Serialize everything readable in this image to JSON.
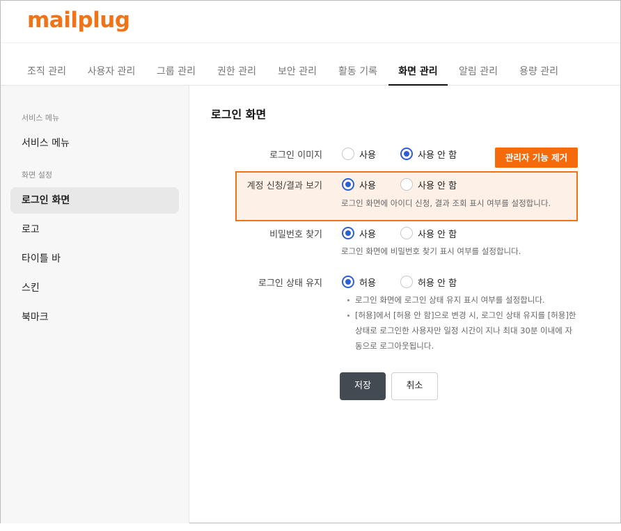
{
  "brand": {
    "logo_text": "mailplug",
    "color": "#f07318"
  },
  "nav": {
    "tabs": [
      {
        "label": "조직 관리"
      },
      {
        "label": "사용자 관리"
      },
      {
        "label": "그룹 관리"
      },
      {
        "label": "권한 관리"
      },
      {
        "label": "보안 관리"
      },
      {
        "label": "활동 기록"
      },
      {
        "label": "화면 관리",
        "active": true
      },
      {
        "label": "알림 관리"
      },
      {
        "label": "용량 관리"
      }
    ]
  },
  "sidebar": {
    "section1_heading": "서비스 메뉴",
    "section1_items": [
      {
        "label": "서비스 메뉴"
      }
    ],
    "section2_heading": "화면 설정",
    "section2_items": [
      {
        "label": "로그인 화면",
        "active": true
      },
      {
        "label": "로고"
      },
      {
        "label": "타이틀 바"
      },
      {
        "label": "스킨"
      },
      {
        "label": "북마크"
      }
    ]
  },
  "main": {
    "title": "로그인 화면",
    "badge": "관리자 기능 제거",
    "settings": [
      {
        "label": "로그인 이미지",
        "options": [
          "사용",
          "사용 안 함"
        ],
        "selected": "사용 안 함"
      },
      {
        "label": "계정 신청/결과 보기",
        "options": [
          "사용",
          "사용 안 함"
        ],
        "selected": "사용",
        "desc": "로그인 화면에 아이디 신청, 결과 조회 표시 여부를 설정합니다."
      },
      {
        "label": "비밀번호 찾기",
        "options": [
          "사용",
          "사용 안 함"
        ],
        "selected": "사용",
        "desc": "로그인 화면에 비밀번호 찾기 표시 여부를 설정합니다."
      },
      {
        "label": "로그인 상태 유지",
        "options": [
          "허용",
          "허용 안 함"
        ],
        "selected": "허용",
        "bullets": [
          "로그인 화면에 로그인 상태 유지 표시 여부를 설정합니다.",
          "[허용]에서 [허용 안 함]으로 변경 시, 로그인 상태 유지를 [허용]한",
          "상태로 로그인한 사용자만 일정 시간이 지나 최대 30분 이내에 자",
          "동으로 로그아웃됩니다."
        ]
      }
    ],
    "buttons": {
      "save": "저장",
      "cancel": "취소"
    }
  },
  "colors": {
    "accent": "#f07318",
    "badge": "#f56a0a",
    "radio": "#2c5fd4",
    "save_button": "#444a52"
  }
}
